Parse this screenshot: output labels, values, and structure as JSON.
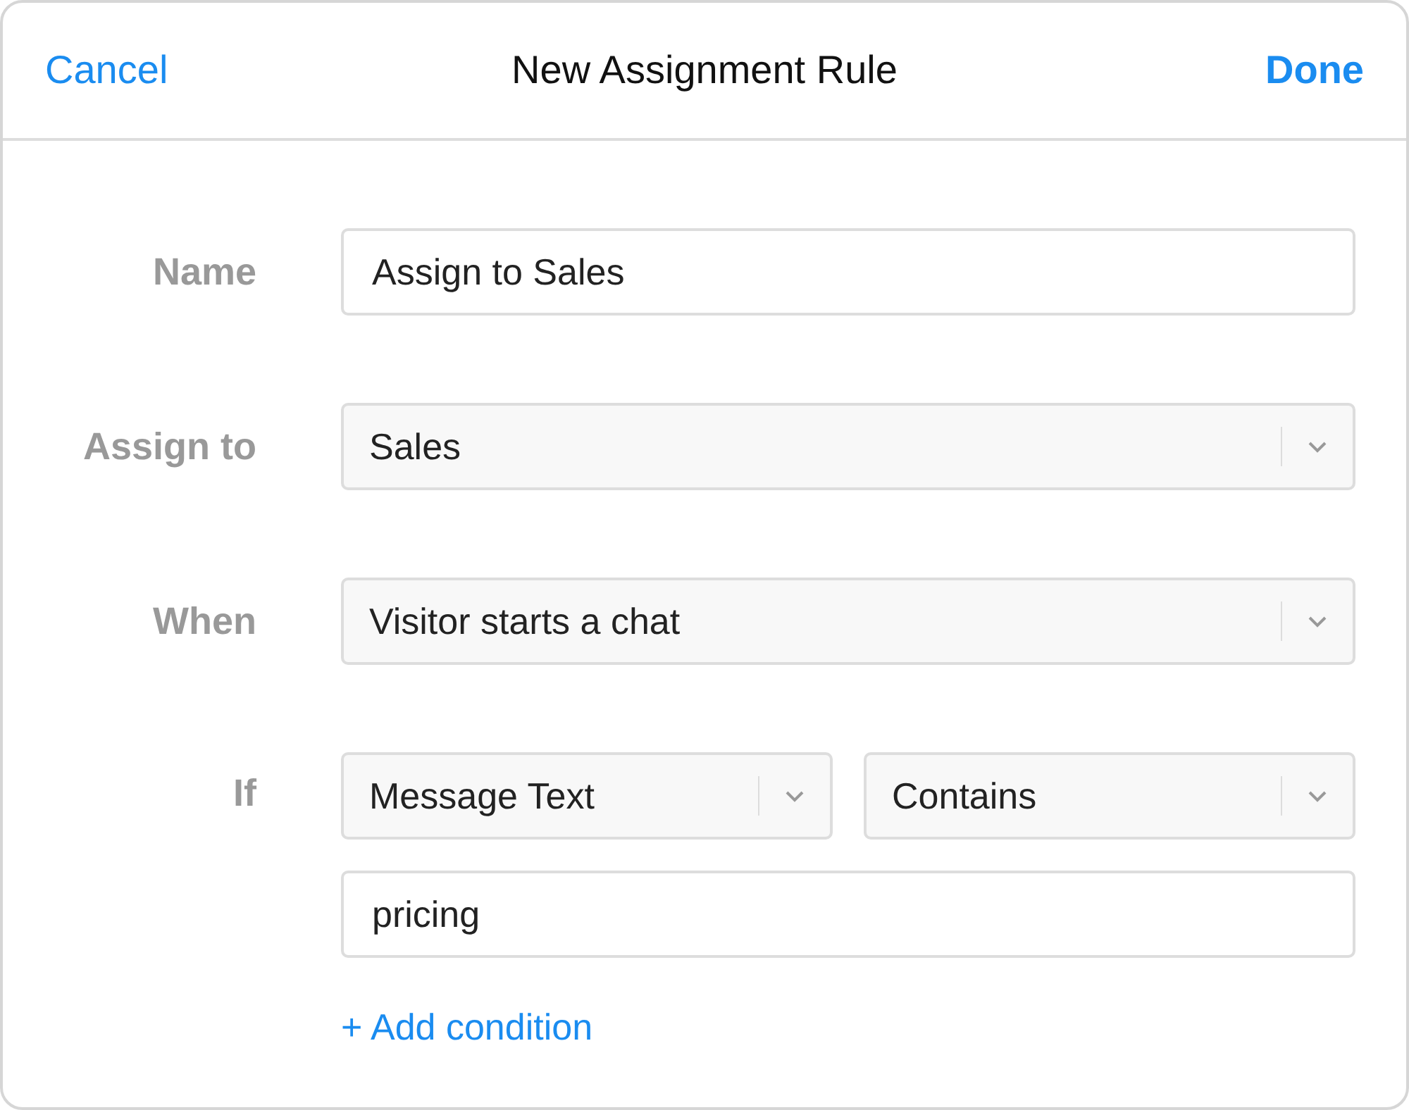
{
  "header": {
    "cancel": "Cancel",
    "title": "New Assignment Rule",
    "done": "Done"
  },
  "fields": [
    {
      "label": "Name",
      "kind": "text",
      "value": "Assign to Sales"
    },
    {
      "label": "Assign to",
      "kind": "select",
      "value": "Sales"
    },
    {
      "label": "When",
      "kind": "select",
      "value": "Visitor starts a chat"
    }
  ],
  "condition": {
    "label": "If",
    "field": "Message Text",
    "operator": "Contains",
    "value": "pricing"
  },
  "add_condition": "+ Add condition"
}
